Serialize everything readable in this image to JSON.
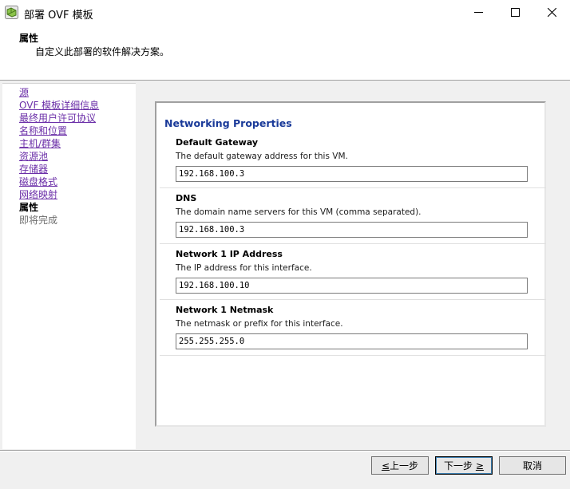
{
  "window": {
    "title": "部署 OVF 模板",
    "icon": "vsphere-icon",
    "controls": [
      "minimize-icon",
      "maximize-icon",
      "close-icon"
    ]
  },
  "header": {
    "title": "属性",
    "subtitle": "自定义此部署的软件解决方案。"
  },
  "nav": {
    "items": [
      {
        "label": "源",
        "state": "link"
      },
      {
        "label": "OVF 模板详细信息",
        "state": "link"
      },
      {
        "label": "最终用户许可协议",
        "state": "link"
      },
      {
        "label": "名称和位置",
        "state": "link"
      },
      {
        "label": "主机/群集",
        "state": "link"
      },
      {
        "label": "资源池",
        "state": "link"
      },
      {
        "label": "存储器",
        "state": "link"
      },
      {
        "label": "磁盘格式",
        "state": "link"
      },
      {
        "label": "网络映射",
        "state": "link"
      },
      {
        "label": "属性",
        "state": "current"
      },
      {
        "label": "即将完成",
        "state": "disabled"
      }
    ]
  },
  "main": {
    "section_title": "Networking Properties",
    "properties": [
      {
        "label": "Default Gateway",
        "description": "The default gateway address for this VM.",
        "value": "192.168.100.3"
      },
      {
        "label": "DNS",
        "description": "The domain name servers for this VM (comma separated).",
        "value": "192.168.100.3"
      },
      {
        "label": "Network 1 IP Address",
        "description": "The IP address for this interface.",
        "value": "192.168.100.10"
      },
      {
        "label": "Network 1 Netmask",
        "description": "The netmask or prefix for this interface.",
        "value": "255.255.255.0"
      }
    ]
  },
  "footer": {
    "back_mnemonic": "≤",
    "back_label": "上一步",
    "next_label": "下一步",
    "next_mnemonic": "≥",
    "cancel_label": "取消"
  },
  "colors": {
    "link": "#6b2fa8",
    "section_title": "#1a3a99",
    "background": "#f0f0f0"
  }
}
